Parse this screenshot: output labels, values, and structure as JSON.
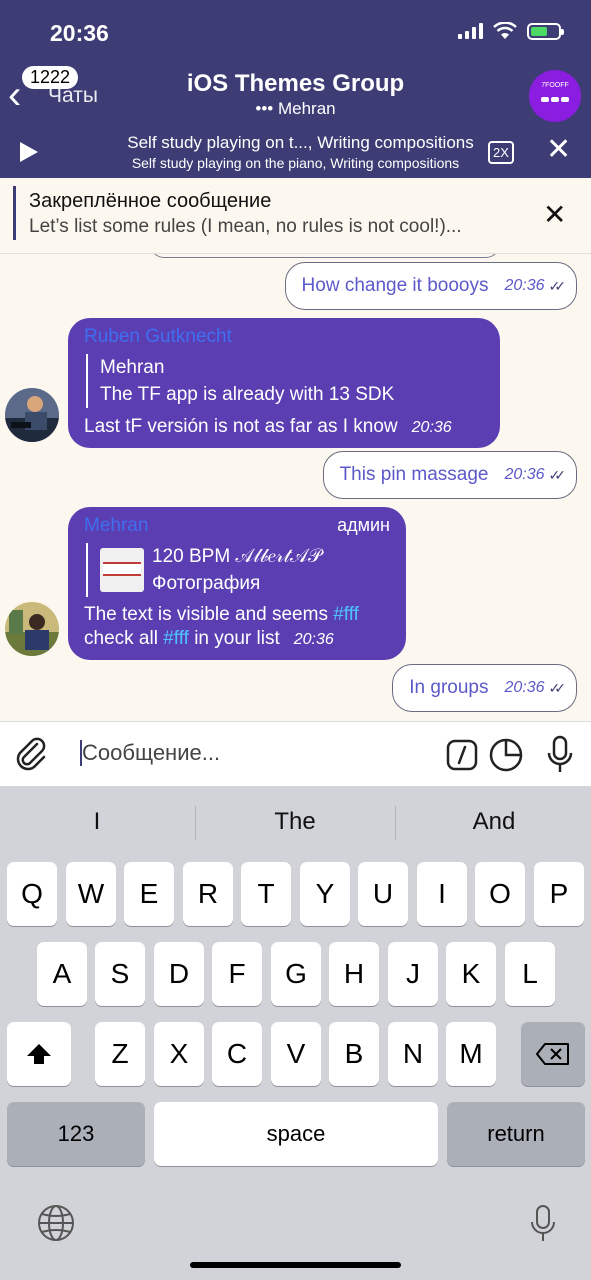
{
  "status": {
    "time": "20:36"
  },
  "nav": {
    "badge": "1222",
    "back_label": "Чаты",
    "title": "iOS Themes Group",
    "subtitle": "••• Mehran",
    "avatar_text": "7FOOFF"
  },
  "player": {
    "title": "Self study playing on t..., Writing compositions",
    "subtitle": "Self study playing on the piano, Writing compositions",
    "speed": "2X"
  },
  "pinned": {
    "title": "Закреплённое сообщение",
    "text": "Let’s list some rules (I mean, no rules is not cool!)..."
  },
  "messages": [
    {
      "text": "How change it boooys",
      "time": "20:36"
    },
    {
      "sender": "Ruben Gutknecht",
      "reply_author": "Mehran",
      "reply_text": "The TF app is already with 13 SDK",
      "text": "Last tF versión is not as far as I know",
      "time": "20:36"
    },
    {
      "text": "This pin massage",
      "time": "20:36"
    },
    {
      "sender": "Mehran",
      "role": "админ",
      "reply_author": "120 BPM 𝒜𝓁𝒷𝑒𝓇𝓉𝒜𝒫",
      "reply_text": "Фотография",
      "text_a": "The text is visible and seems ",
      "link_a": "#fff",
      "text_b": "check all ",
      "link_b": "#fff",
      "text_c": " in your list",
      "time": "20:36"
    },
    {
      "text": "In groups",
      "time": "20:36"
    }
  ],
  "input": {
    "placeholder": "Сообщение..."
  },
  "keyboard": {
    "suggestions": [
      "I",
      "The",
      "And"
    ],
    "row1": [
      "Q",
      "W",
      "E",
      "R",
      "T",
      "Y",
      "U",
      "I",
      "O",
      "P"
    ],
    "row2": [
      "A",
      "S",
      "D",
      "F",
      "G",
      "H",
      "J",
      "K",
      "L"
    ],
    "row3": [
      "Z",
      "X",
      "C",
      "V",
      "B",
      "N",
      "M"
    ],
    "numbers": "123",
    "space": "space",
    "return": "return"
  },
  "colors": {
    "header": "#3d3c74",
    "bubble_in": "#5b3fb2",
    "accent": "#5c59c9",
    "link": "#4fc3ff"
  }
}
